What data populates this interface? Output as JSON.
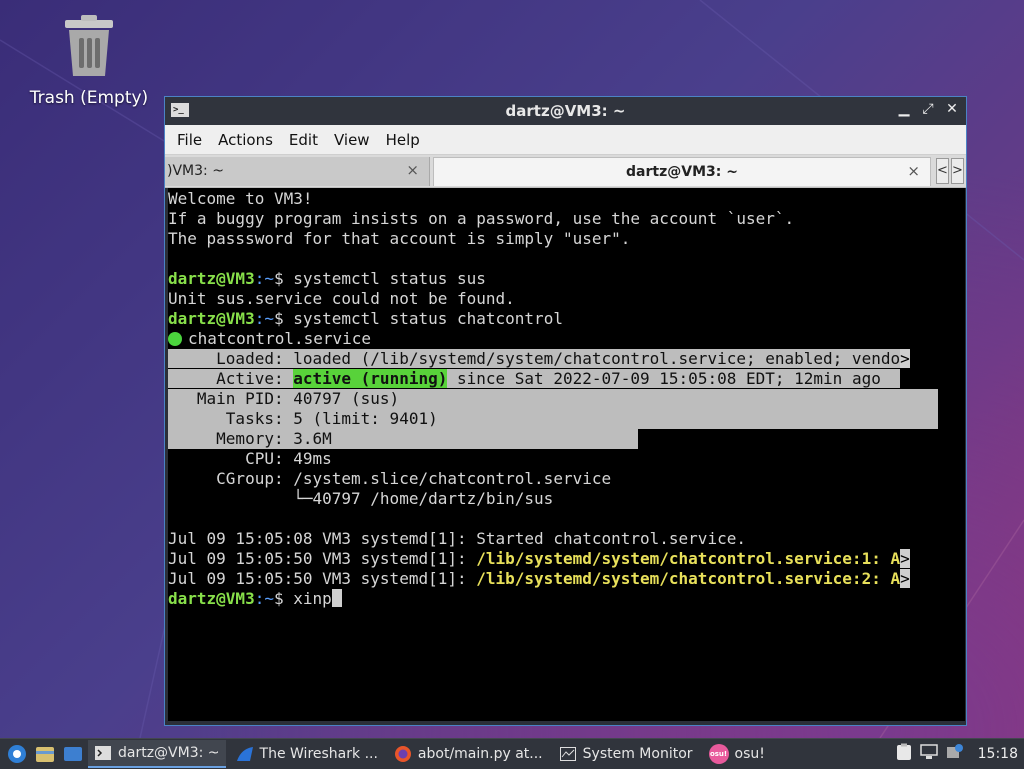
{
  "desktop": {
    "trash_label": "Trash (Empty)"
  },
  "window": {
    "title": "dartz@VM3: ~",
    "menu": [
      "File",
      "Actions",
      "Edit",
      "View",
      "Help"
    ],
    "tabs": [
      {
        "label": ")VM3: ~",
        "active": false
      },
      {
        "label": "dartz@VM3: ~",
        "active": true
      }
    ],
    "tab_close_glyph": "×",
    "tab_prev_glyph": "<",
    "tab_next_glyph": ">"
  },
  "terminal": {
    "welcome": [
      "Welcome to VM3!",
      "If a buggy program insists on a password, use the account `user`.",
      "The passsword for that account is simply \"user\"."
    ],
    "prompt_user": "dartz@VM3",
    "prompt_path": ":~",
    "prompt_sign": "$ ",
    "cmd1": "systemctl status sus",
    "out1": "Unit sus.service could not be found.",
    "cmd2": "systemctl status chatcontrol",
    "service_name": "chatcontrol.service",
    "loaded": "     Loaded: loaded (/lib/systemd/system/chatcontrol.service; enabled; vendo",
    "active_label": "     Active: ",
    "active_state": "active (running)",
    "active_rest": " since Sat 2022-07-09 15:05:08 EDT; 12min ago",
    "main_pid": "   Main PID: 40797 (sus)",
    "tasks": "      Tasks: 5 (limit: 9401)",
    "memory": "     Memory: 3.6M",
    "cpu": "        CPU: 49ms",
    "cgroup": "     CGroup: /system.slice/chatcontrol.service",
    "cgroup_child": "             └─40797 /home/dartz/bin/sus",
    "log1": "Jul 09 15:05:08 VM3 systemd[1]: Started chatcontrol.service.",
    "log2_prefix": "Jul 09 15:05:50 VM3 systemd[1]: ",
    "log2_msg": "/lib/systemd/system/chatcontrol.service:1: A",
    "log3_prefix": "Jul 09 15:05:50 VM3 systemd[1]: ",
    "log3_msg": "/lib/systemd/system/chatcontrol.service:2: A",
    "trunc": ">",
    "current_input": "xinp"
  },
  "taskbar": {
    "tasks": [
      {
        "label": "dartz@VM3: ~",
        "active": true
      },
      {
        "label": "The Wireshark ..."
      },
      {
        "label": "abot/main.py at..."
      },
      {
        "label": "System Monitor"
      },
      {
        "label": "osu!"
      }
    ],
    "osu_badge": "osu!",
    "clock": "15:18"
  },
  "colors": {
    "accent": "#4b83c5",
    "prompt_green": "#88e04a",
    "log_yellow": "#e8e05a",
    "selection": "#bdbdbd"
  }
}
